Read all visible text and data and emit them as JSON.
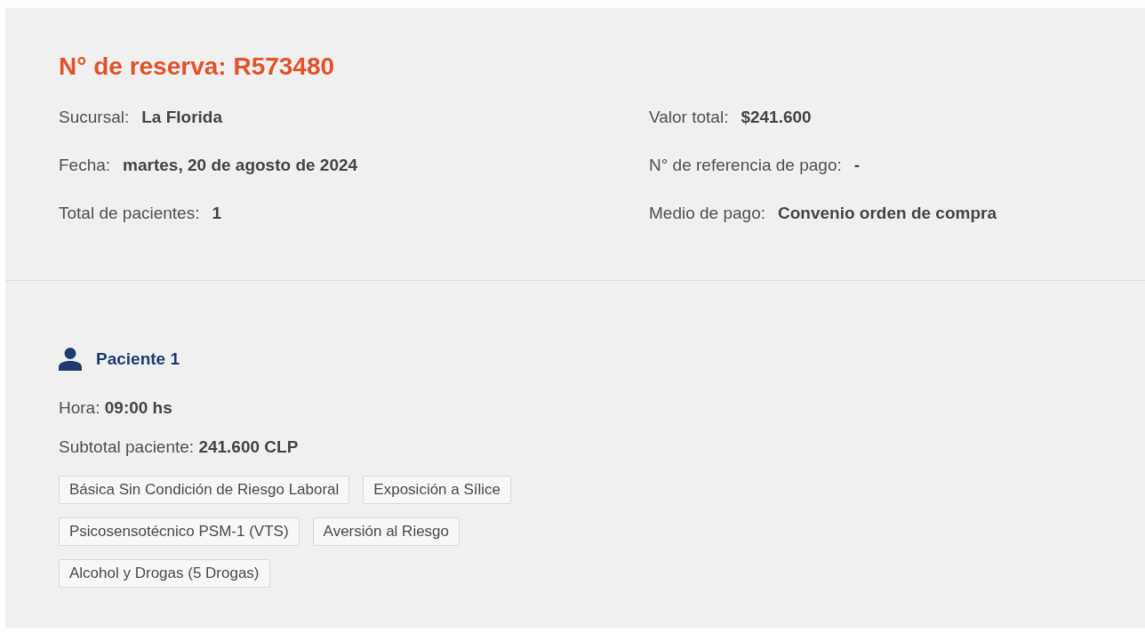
{
  "reservation": {
    "title": "N° de reserva: R573480",
    "details_left": [
      {
        "label": "Sucursal:",
        "value": "La Florida"
      },
      {
        "label": "Fecha:",
        "value": "martes, 20 de agosto de 2024"
      },
      {
        "label": "Total de pacientes:",
        "value": "1"
      }
    ],
    "details_right": [
      {
        "label": "Valor total:",
        "value": "$241.600"
      },
      {
        "label": "N° de referencia de pago:",
        "value": "-"
      },
      {
        "label": "Medio de pago:",
        "value": "Convenio orden de compra"
      }
    ]
  },
  "patients": [
    {
      "title": "Paciente 1",
      "fields": [
        "Hora: **09:00 hs**",
        "Subtotal paciente: **241.600 CLP**"
      ],
      "tags": [
        "Básica Sin Condición de Riesgo Laboral",
        "Exposición a Sílice",
        "Psicosensotécnico PSM-1 (VTS)",
        "Aversión al Riesgo",
        "Alcohol y Drogas (5 Drogas)"
      ]
    }
  ]
}
